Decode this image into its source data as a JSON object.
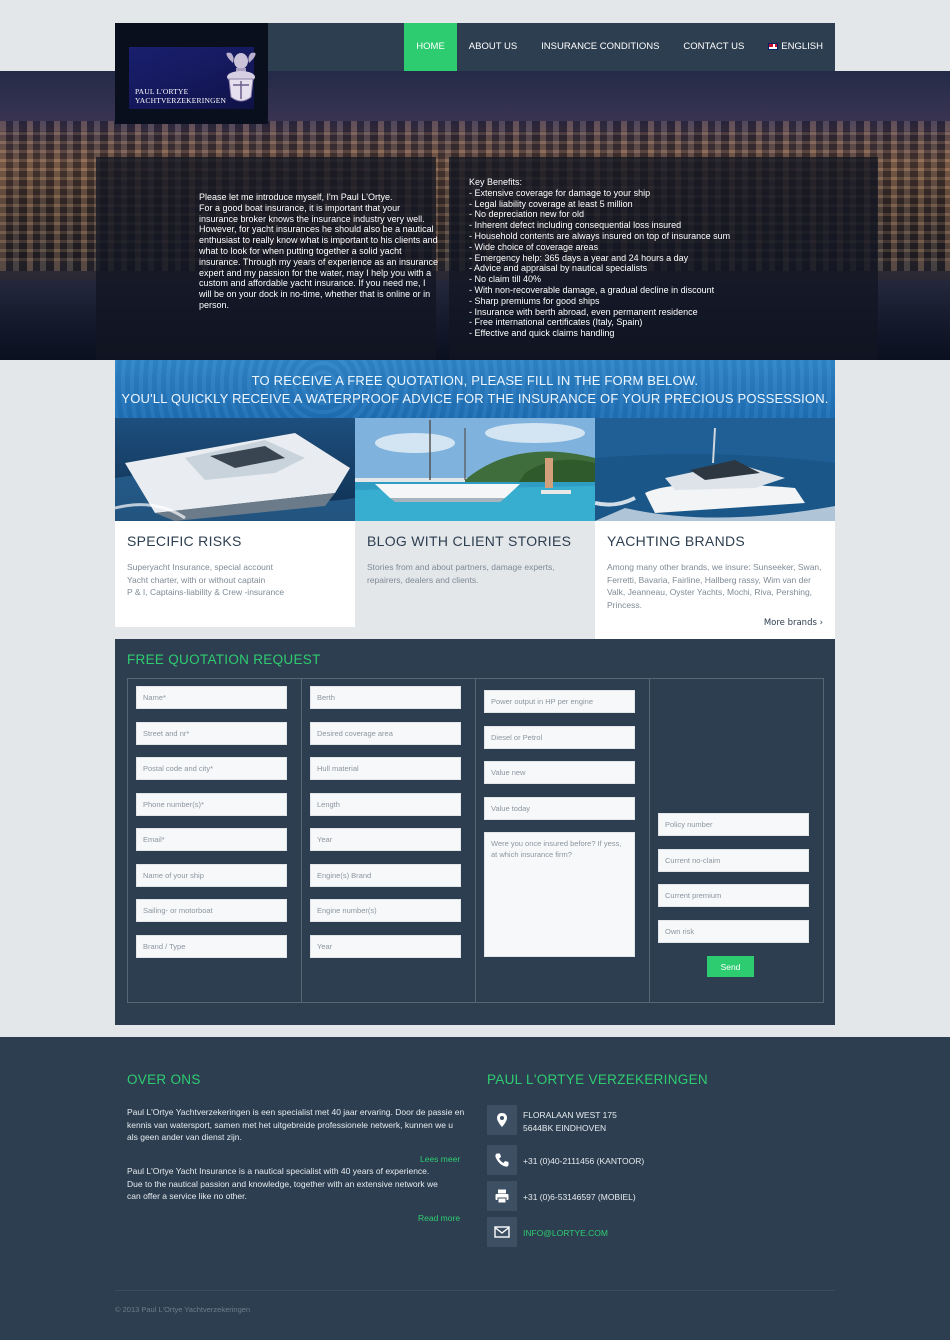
{
  "brand": {
    "name_line1": "PAUL L'ORTYE",
    "name_line2": "YACHTVERZEKERINGEN"
  },
  "nav": {
    "items": [
      {
        "label": "HOME",
        "active": true
      },
      {
        "label": "ABOUT US",
        "active": false
      },
      {
        "label": "INSURANCE CONDITIONS",
        "active": false
      },
      {
        "label": "CONTACT US",
        "active": false
      },
      {
        "label": "ENGLISH",
        "active": false,
        "icon": "uk-flag-icon"
      }
    ]
  },
  "hero": {
    "intro": "Please let me introduce myself, I'm Paul L'Ortye.\nFor a good boat insurance, it is important that your insurance broker knows the insurance industry very well. However, for yacht insurances he should also be a nautical enthusiast to really know what is important to his clients and what to look for when putting together a solid yacht insurance. Through my years of experience as an insurance expert and my passion for the water, may I help you with a custom and affordable yacht insurance. If you need me, I will be on your dock in no-time, whether that is online or in person.",
    "benefits_title": "Key Benefits:",
    "benefits": [
      "- Extensive coverage for damage to your ship",
      "- Legal liability coverage at least 5 million",
      "- No depreciation new for old",
      "- Inherent defect including consequential loss insured",
      "- Household contents are always insured on top of insurance sum",
      "- Wide choice of coverage areas",
      "- Emergency help: 365 days a year and 24 hours a day",
      "- Advice and appraisal by nautical specialists",
      "- No claim till 40%",
      "- With non-recoverable damage, a gradual decline in discount",
      "- Sharp premiums for good ships",
      "- Insurance with berth abroad, even permanent residence",
      "- Free international certificates (Italy, Spain)",
      "- Effective and quick claims handling"
    ]
  },
  "banner": {
    "line1": "TO RECEIVE A FREE QUOTATION, PLEASE FILL IN THE FORM BELOW.",
    "line2": "YOU'LL QUICKLY RECEIVE A WATERPROOF ADVICE FOR THE INSURANCE OF YOUR PRECIOUS POSSESSION."
  },
  "features": [
    {
      "title": "SPECIFIC RISKS",
      "text": "Superyacht Insurance, special account\nYacht charter, with or without captain\nP & I, Captains-liability & Crew -insurance"
    },
    {
      "title": "BLOG WITH CLIENT STORIES",
      "text": "Stories from and about partners, damage experts, repairers, dealers and clients."
    },
    {
      "title": "YACHTING BRANDS",
      "text": "Among many other brands, we insure: Sunseeker, Swan, Ferretti, Bavaria, Fairline, Hallberg rassy, Wim van der Valk, Jeanneau, Oyster Yachts, Mochi, Riva, Pershing, Princess.",
      "more": "More brands ›"
    }
  ],
  "form": {
    "title": "FREE QUOTATION REQUEST",
    "col1": [
      "Name*",
      "Street and nr*",
      "Postal code and city*",
      "Phone number(s)*",
      "Email*",
      "Name of your ship",
      "Sailing- or motorboat",
      "Brand / Type"
    ],
    "col2": [
      "Berth",
      "Desired coverage area",
      "Hull material",
      "Length",
      "Year",
      "Engine(s) Brand",
      "Engine number(s)",
      "Year"
    ],
    "col3": [
      "Power output in HP per engine",
      "Diesel or Petrol",
      "Value new",
      "Value today"
    ],
    "col3_textarea": "Were you once insured before? If yess, at which insurance firm?",
    "col4": [
      "Policy number",
      "Current no-claim",
      "Current premium",
      "Own risk"
    ],
    "send": "Send"
  },
  "footer": {
    "about_title": "OVER ONS",
    "about_nl": "Paul L'Ortye Yachtverzekeringen is een specialist met 40 jaar ervaring. Door de passie en kennis van watersport, samen met het uitgebreide professionele netwerk, kunnen we u als geen ander van dienst zijn.",
    "read_more_nl": "Lees meer",
    "about_en": "Paul L'Ortye Yacht Insurance is a nautical specialist with 40 years of experience. Due to the nautical passion and knowledge, together with an extensive network we can offer a service like no other.",
    "read_more_en": "Read more",
    "contact_title": "PAUL L'ORTYE VERZEKERINGEN",
    "address_line1": "FLORALAAN WEST 175",
    "address_line2": "5644BK EINDHOVEN",
    "phone_office": "+31 (0)40-2111456 (KANTOOR)",
    "phone_mobile": "+31 (0)6-53146597 (MOBIEL)",
    "email": "INFO@LORTYE.COM",
    "copyright": "© 2013 Paul L'Ortye Yachtverzekeringen"
  },
  "colors": {
    "accent": "#2ecc71",
    "navy": "#2d3e50",
    "banner_blue": "#2a80c4",
    "page_bg": "#e4e7ea"
  }
}
